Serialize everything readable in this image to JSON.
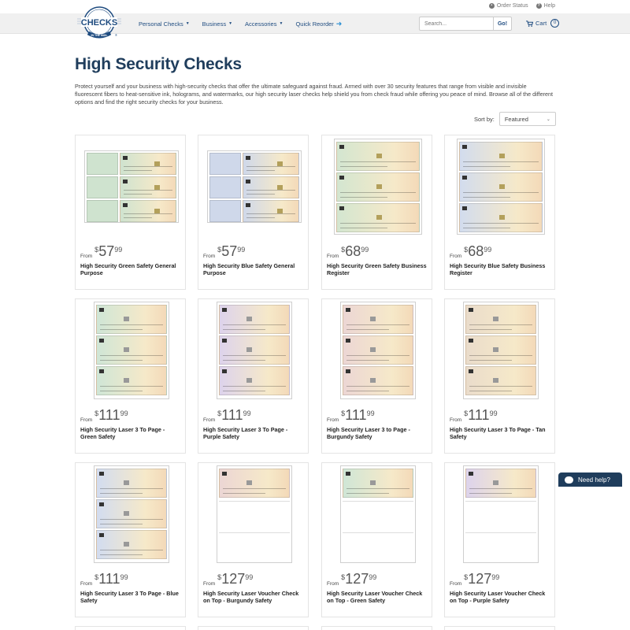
{
  "header": {
    "order_status": "Order Status",
    "help": "Help",
    "nav": [
      {
        "label": "Personal Checks",
        "dropdown": true
      },
      {
        "label": "Business",
        "dropdown": true
      },
      {
        "label": "Accessories",
        "dropdown": true
      },
      {
        "label": "Quick Reorder",
        "dropdown": false
      }
    ],
    "search_placeholder": "Search...",
    "search_button": "Go!",
    "cart_label": "Cart",
    "cart_count": "0",
    "logo_text_top": "CHECKS",
    "logo_text_bottom": "IN THE MAIL"
  },
  "page": {
    "title": "High Security Checks",
    "intro": "Protect yourself and your business with high-security checks that offer the ultimate safeguard against fraud. Armed with over 30 security features that range from visible and invisible fluorescent fibers to heat-sensitive ink, holograms, and watermarks, our high security laser checks help shield you from check fraud while offering you peace of mind. Browse all of the different options and find the right security checks for your business.",
    "sort_label": "Sort by:",
    "sort_value": "Featured"
  },
  "products": [
    {
      "from": "From",
      "dollar": "$",
      "whole": "57",
      "cents": "99",
      "name": "High Security Green Safety General Purpose",
      "tint": "#cfe3cf",
      "style": "general"
    },
    {
      "from": "From",
      "dollar": "$",
      "whole": "57",
      "cents": "99",
      "name": "High Security Blue Safety General Purpose",
      "tint": "#cfd8ea",
      "style": "general"
    },
    {
      "from": "From",
      "dollar": "$",
      "whole": "68",
      "cents": "99",
      "name": "High Security Green Safety Business Register",
      "tint": "#d3e6d0",
      "style": "register"
    },
    {
      "from": "From",
      "dollar": "$",
      "whole": "68",
      "cents": "99",
      "name": "High Security Blue Safety Business Register",
      "tint": "#d2dcee",
      "style": "register"
    },
    {
      "from": "From",
      "dollar": "$",
      "whole": "111",
      "cents": "99",
      "name": "High Security Laser 3 To Page - Green Safety",
      "tint": "#cfe6d6",
      "style": "laser3"
    },
    {
      "from": "From",
      "dollar": "$",
      "whole": "111",
      "cents": "99",
      "name": "High Security Laser 3 To Page - Purple Safety",
      "tint": "#ddd3ec",
      "style": "laser3"
    },
    {
      "from": "From",
      "dollar": "$",
      "whole": "111",
      "cents": "99",
      "name": "High Security Laser 3 to Page - Burgundy Safety",
      "tint": "#ecd6d4",
      "style": "laser3"
    },
    {
      "from": "From",
      "dollar": "$",
      "whole": "111",
      "cents": "99",
      "name": "High Security Laser 3 To Page - Tan Safety",
      "tint": "#eadccb",
      "style": "laser3"
    },
    {
      "from": "From",
      "dollar": "$",
      "whole": "111",
      "cents": "99",
      "name": "High Security Laser 3 To Page - Blue Safety",
      "tint": "#d2dcf0",
      "style": "laser3"
    },
    {
      "from": "From",
      "dollar": "$",
      "whole": "127",
      "cents": "99",
      "name": "High Security Laser Voucher Check on Top - Burgundy Safety",
      "tint": "#ecd6d4",
      "style": "voucher"
    },
    {
      "from": "From",
      "dollar": "$",
      "whole": "127",
      "cents": "99",
      "name": "High Security Laser Voucher Check on Top - Green Safety",
      "tint": "#cfe6d6",
      "style": "voucher"
    },
    {
      "from": "From",
      "dollar": "$",
      "whole": "127",
      "cents": "99",
      "name": "High Security Laser Voucher Check on Top - Purple Safety",
      "tint": "#ddd3ec",
      "style": "voucher"
    }
  ],
  "help_tab": "Need help?"
}
